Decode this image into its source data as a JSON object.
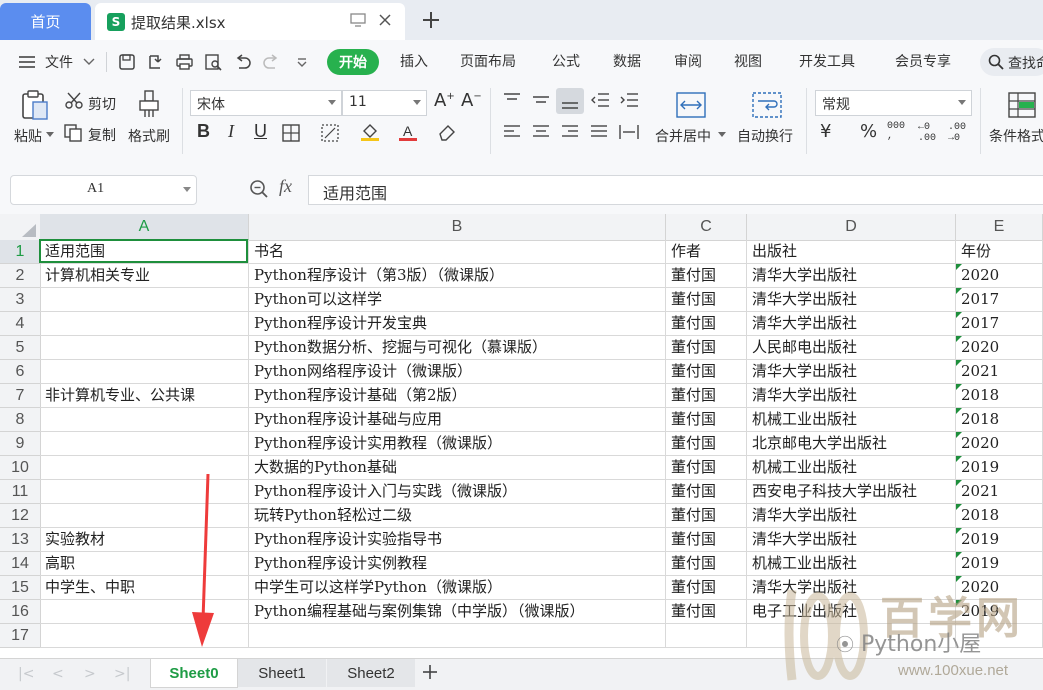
{
  "tabs": {
    "home": "首页",
    "file": {
      "icon_letter": "S",
      "name": "提取结果.xlsx"
    }
  },
  "menu": {
    "file": "文件",
    "items": [
      "开始",
      "插入",
      "页面布局",
      "公式",
      "数据",
      "审阅",
      "视图",
      "开发工具",
      "会员专享"
    ],
    "search": "查找命"
  },
  "ribbon": {
    "paste": "粘贴",
    "cut": "剪切",
    "copy": "复制",
    "format_painter": "格式刷",
    "font_name": "宋体",
    "font_size": "11",
    "merge_center": "合并居中",
    "wrap_text": "自动换行",
    "number_format": "常规",
    "conditional_format": "条件格式",
    "bold": "B",
    "italic": "I",
    "underline": "U"
  },
  "formula_bar": {
    "name_box": "A1",
    "fx": "fx",
    "value": "适用范围"
  },
  "grid": {
    "columns": [
      "A",
      "B",
      "C",
      "D",
      "E"
    ],
    "row_numbers": [
      "1",
      "2",
      "3",
      "4",
      "5",
      "6",
      "7",
      "8",
      "9",
      "10",
      "11",
      "12",
      "13",
      "14",
      "15",
      "16",
      "17"
    ],
    "rows": [
      [
        "适用范围",
        "书名",
        "作者",
        "出版社",
        "年份"
      ],
      [
        "计算机相关专业",
        "Python程序设计（第3版）（微课版）",
        "董付国",
        "清华大学出版社",
        "2020"
      ],
      [
        "",
        "Python可以这样学",
        "董付国",
        "清华大学出版社",
        "2017"
      ],
      [
        "",
        "Python程序设计开发宝典",
        "董付国",
        "清华大学出版社",
        "2017"
      ],
      [
        "",
        "Python数据分析、挖掘与可视化（慕课版）",
        "董付国",
        "人民邮电出版社",
        "2020"
      ],
      [
        "",
        "Python网络程序设计（微课版）",
        "董付国",
        "清华大学出版社",
        "2021"
      ],
      [
        "非计算机专业、公共课",
        "Python程序设计基础（第2版）",
        "董付国",
        "清华大学出版社",
        "2018"
      ],
      [
        "",
        "Python程序设计基础与应用",
        "董付国",
        "机械工业出版社",
        "2018"
      ],
      [
        "",
        "Python程序设计实用教程（微课版）",
        "董付国",
        "北京邮电大学出版社",
        "2020"
      ],
      [
        "",
        "大数据的Python基础",
        "董付国",
        "机械工业出版社",
        "2019"
      ],
      [
        "",
        "Python程序设计入门与实践（微课版）",
        "董付国",
        "西安电子科技大学出版社",
        "2021"
      ],
      [
        "",
        "玩转Python轻松过二级",
        "董付国",
        "清华大学出版社",
        "2018"
      ],
      [
        "实验教材",
        "Python程序设计实验指导书",
        "董付国",
        "清华大学出版社",
        "2019"
      ],
      [
        "高职",
        "Python程序设计实例教程",
        "董付国",
        "机械工业出版社",
        "2019"
      ],
      [
        "中学生、中职",
        "中学生可以这样学Python（微课版）",
        "董付国",
        "清华大学出版社",
        "2020"
      ],
      [
        "",
        "Python编程基础与案例集锦（中学版）（微课版）",
        "董付国",
        "电子工业出版社",
        "2019"
      ],
      [
        "",
        "",
        "",
        "",
        ""
      ]
    ]
  },
  "sheets": [
    "Sheet0",
    "Sheet1",
    "Sheet2"
  ],
  "active_sheet": "Sheet0",
  "watermark": {
    "brand": "百学网",
    "account": "Python小屋",
    "url": "www.100xue.net"
  },
  "colors": {
    "accent_green": "#27b14e",
    "home_tab_blue": "#5b8def",
    "arrow_red": "#ee3b3b",
    "selection_border": "#1e8f3c"
  }
}
